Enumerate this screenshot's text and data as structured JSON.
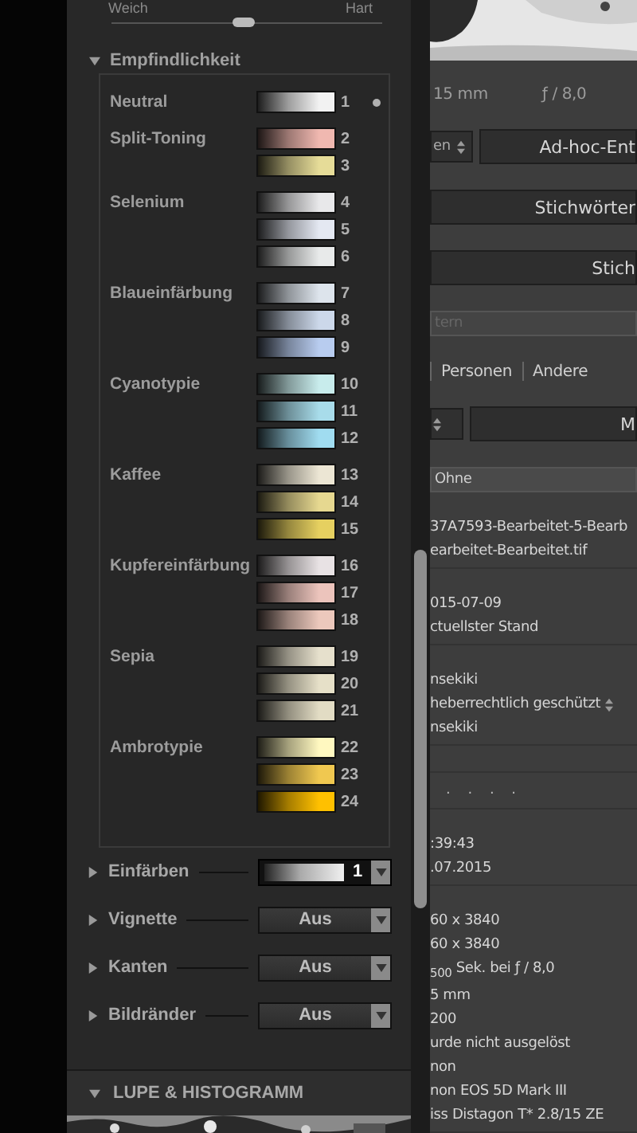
{
  "left_panel": {
    "slider": {
      "min_label": "Weich",
      "max_label": "Hart",
      "level": 0.49
    },
    "section": {
      "title": "Empfindlichkeit",
      "expanded": true
    },
    "toning_menu": {
      "groups": [
        {
          "label": "Neutral",
          "items": [
            {
              "number": "1",
              "color": "#f2f2f2",
              "selected": true
            }
          ]
        },
        {
          "label": "Split-Toning",
          "items": [
            {
              "number": "2",
              "color": "#f0b8b0",
              "selected": false
            },
            {
              "number": "3",
              "color": "#e6dc98",
              "selected": false
            }
          ]
        },
        {
          "label": "Selenium",
          "items": [
            {
              "number": "4",
              "color": "#e8e8ea",
              "selected": false
            },
            {
              "number": "5",
              "color": "#e4e8f2",
              "selected": false
            },
            {
              "number": "6",
              "color": "#e8eaea",
              "selected": false
            }
          ]
        },
        {
          "label": "Blaueinfärbung",
          "items": [
            {
              "number": "7",
              "color": "#dde4ec",
              "selected": false
            },
            {
              "number": "8",
              "color": "#ccd8ea",
              "selected": false
            },
            {
              "number": "9",
              "color": "#b8ccef",
              "selected": false
            }
          ]
        },
        {
          "label": "Cyanotypie",
          "items": [
            {
              "number": "10",
              "color": "#c8ecec",
              "selected": false
            },
            {
              "number": "11",
              "color": "#a8dcea",
              "selected": false
            },
            {
              "number": "12",
              "color": "#a0dcf0",
              "selected": false
            }
          ]
        },
        {
          "label": "Kaffee",
          "items": [
            {
              "number": "13",
              "color": "#ece6d4",
              "selected": false
            },
            {
              "number": "14",
              "color": "#e6d890",
              "selected": false
            },
            {
              "number": "15",
              "color": "#e6d060",
              "selected": false
            }
          ]
        },
        {
          "label": "Kupfereinfärbung",
          "items": [
            {
              "number": "16",
              "color": "#e8e2e4",
              "selected": false
            },
            {
              "number": "17",
              "color": "#ecc4bc",
              "selected": false
            },
            {
              "number": "18",
              "color": "#ecc8bc",
              "selected": false
            }
          ]
        },
        {
          "label": "Sepia",
          "items": [
            {
              "number": "19",
              "color": "#e6e0cc",
              "selected": false
            },
            {
              "number": "20",
              "color": "#e6e0c8",
              "selected": false
            },
            {
              "number": "21",
              "color": "#e2dcc4",
              "selected": false
            }
          ]
        },
        {
          "label": "Ambrotypie",
          "items": [
            {
              "number": "22",
              "color": "#fff8c0",
              "selected": false
            },
            {
              "number": "23",
              "color": "#f0c850",
              "selected": false
            },
            {
              "number": "24",
              "color": "#ffc000",
              "selected": false
            }
          ]
        }
      ]
    },
    "effects": [
      {
        "kind": "swatch",
        "label": "Einfärben",
        "value": "1",
        "expanded": false
      },
      {
        "kind": "select",
        "label": "Vignette",
        "value": "Aus",
        "expanded": false
      },
      {
        "kind": "select",
        "label": "Kanten",
        "value": "Aus",
        "expanded": false
      },
      {
        "kind": "select",
        "label": "Bildränder",
        "value": "Aus",
        "expanded": false
      }
    ],
    "panel_header": {
      "title": "LUPE & HISTOGRAMM",
      "expanded": true
    }
  },
  "right_panel": {
    "rows": [
      {
        "kind": "picture"
      },
      {
        "kind": "exif",
        "texts": [
          "15 mm",
          "ƒ / 8,0"
        ]
      },
      {
        "kind": "select_button",
        "select": "en",
        "label": "Ad-hoc-Ent"
      },
      {
        "kind": "button",
        "label": "Stichwörter"
      },
      {
        "kind": "button",
        "label": "Stich"
      },
      {
        "kind": "field",
        "placeholder": "tern"
      },
      {
        "kind": "tabs",
        "tabs": [
          {
            "label": "Personen",
            "selected": false
          },
          {
            "label": "Andere",
            "selected": false
          }
        ]
      },
      {
        "kind": "select_button",
        "label": "M"
      },
      {
        "kind": "field",
        "value": "Ohne"
      },
      {
        "kind": "lines",
        "lines": [
          {
            "kind": "text",
            "text": "37A7593-Bearbeitet-5-Bearb"
          },
          {
            "kind": "text",
            "text": "earbeitet-Bearbeitet.tif"
          }
        ]
      },
      {
        "kind": "lines",
        "lines": [
          {
            "kind": "text",
            "text": "015-07-09"
          },
          {
            "kind": "text",
            "text": "ctuellster Stand"
          }
        ]
      },
      {
        "kind": "lines",
        "lines": [
          {
            "kind": "text",
            "text": "nsekiki"
          },
          {
            "kind": "select",
            "text": "heberrechtlich geschützt"
          },
          {
            "kind": "text",
            "text": "nsekiki"
          }
        ]
      },
      {
        "kind": "dots",
        "text": ". . . ."
      },
      {
        "kind": "lines",
        "lines": [
          {
            "kind": "text",
            "text": ":39:43"
          },
          {
            "kind": "text",
            "text": ".07.2015"
          }
        ]
      },
      {
        "kind": "lines",
        "lines": [
          {
            "kind": "text",
            "text": "60 x 3840"
          },
          {
            "kind": "text",
            "text": "60 x 3840"
          },
          {
            "kind": "text",
            "text": "$_{500}$ Sek. bei ƒ / 8,0"
          },
          {
            "kind": "text",
            "text": "5 mm"
          },
          {
            "kind": "text",
            "text": "200"
          },
          {
            "kind": "text",
            "text": "urde nicht ausgelöst"
          },
          {
            "kind": "text",
            "text": "non"
          },
          {
            "kind": "text",
            "text": "non EOS 5D Mark III"
          },
          {
            "kind": "text",
            "text": "iss Distagon T* 2.8/15 ZE"
          }
        ]
      }
    ]
  }
}
